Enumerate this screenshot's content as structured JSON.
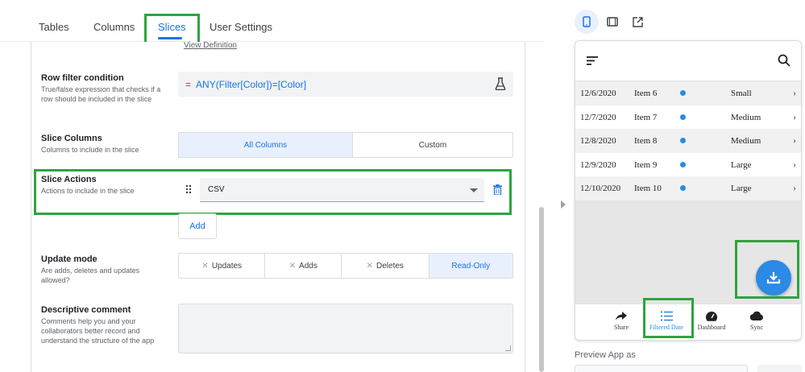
{
  "tabs": [
    {
      "label": "Tables"
    },
    {
      "label": "Columns"
    },
    {
      "label": "Slices"
    },
    {
      "label": "User Settings"
    }
  ],
  "slice_editor": {
    "view_definition_link": "View Definition",
    "row_filter": {
      "label": "Row filter condition",
      "description": "True/false expression that checks if a row should be included in the slice",
      "expression_prefix": "=",
      "expression": "ANY(Filter[Color])=[Color]"
    },
    "slice_columns": {
      "label": "Slice Columns",
      "description": "Columns to include in the slice",
      "options": [
        "All Columns",
        "Custom"
      ],
      "selected": "All Columns"
    },
    "slice_actions": {
      "label": "Slice Actions",
      "description": "Actions to include in the slice",
      "items": [
        {
          "value": "CSV"
        }
      ],
      "add_label": "Add"
    },
    "update_mode": {
      "label": "Update mode",
      "description": "Are adds, deletes and updates allowed?",
      "options": [
        "Updates",
        "Adds",
        "Deletes",
        "Read-Only"
      ],
      "selected": "Read-Only"
    },
    "descriptive_comment": {
      "label": "Descriptive comment",
      "description": "Comments help you and your collaborators better record and understand the structure of the app",
      "value": ""
    }
  },
  "preview": {
    "rows": [
      {
        "date": "12/6/2020",
        "item": "Item 6",
        "size": "Small"
      },
      {
        "date": "12/7/2020",
        "item": "Item 7",
        "size": "Medium"
      },
      {
        "date": "12/8/2020",
        "item": "Item 8",
        "size": "Medium"
      },
      {
        "date": "12/9/2020",
        "item": "Item 9",
        "size": "Large"
      },
      {
        "date": "12/10/2020",
        "item": "Item 10",
        "size": "Large"
      }
    ],
    "dot_color": "#2a8ae5",
    "nav": [
      {
        "label": "Share",
        "icon": "share-icon"
      },
      {
        "label": "Filtered Date",
        "icon": "list-icon"
      },
      {
        "label": "Dashboard",
        "icon": "dashboard-icon"
      },
      {
        "label": "Sync",
        "icon": "cloud-icon"
      }
    ],
    "active_nav": "Filtered Date",
    "preview_as_label": "Preview App as"
  },
  "colors": {
    "accent": "#1a73e8",
    "highlight": "#2da53e",
    "app_blue": "#2a8ae5"
  }
}
